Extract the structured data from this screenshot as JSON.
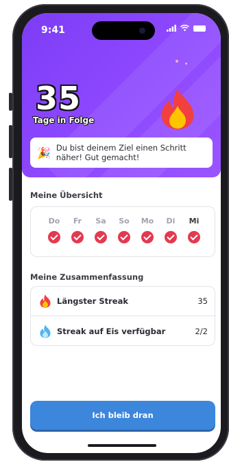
{
  "status_bar": {
    "time": "9:41",
    "signal_icon": "signal-icon",
    "wifi_icon": "wifi-icon",
    "battery_icon": "battery-icon"
  },
  "hero": {
    "streak_count": "35",
    "streak_label": "Tage in Folge",
    "flame_icon": "flame-icon",
    "background_color": "#8a45ff",
    "message": {
      "icon": "party-popper-icon",
      "text": "Du bist deinem Ziel einen Schritt näher! Gut gemacht!"
    }
  },
  "overview": {
    "title": "Meine Übersicht",
    "days": [
      {
        "label": "Do",
        "done": true
      },
      {
        "label": "Fr",
        "done": true
      },
      {
        "label": "Sa",
        "done": true
      },
      {
        "label": "So",
        "done": true
      },
      {
        "label": "Mo",
        "done": true
      },
      {
        "label": "Di",
        "done": true
      },
      {
        "label": "Mi",
        "done": true,
        "today": true
      }
    ],
    "check_color": "#e23a50"
  },
  "summary": {
    "title": "Meine Zusammenfassung",
    "rows": [
      {
        "icon": "flame-icon",
        "label": "Längster Streak",
        "value": "35"
      },
      {
        "icon": "ice-flame-icon",
        "label": "Streak auf Eis verfügbar",
        "value": "2/2"
      }
    ]
  },
  "cta": {
    "label": "Ich bleib dran",
    "color": "#3c86dc"
  }
}
